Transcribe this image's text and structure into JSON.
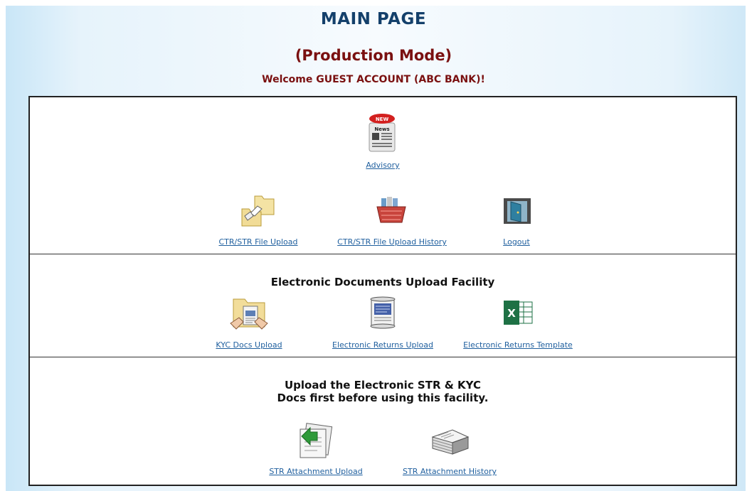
{
  "header": {
    "title": "MAIN PAGE",
    "mode": "(Production Mode)",
    "welcome": "Welcome GUEST ACCOUNT (ABC BANK)!"
  },
  "section_main": {
    "advisory": {
      "label": "Advisory",
      "icon": "news-icon"
    },
    "file_upload": {
      "label": "CTR/STR File Upload",
      "icon": "folder-transfer-icon"
    },
    "upload_history": {
      "label": "CTR/STR File Upload History",
      "icon": "basket-icon"
    },
    "logout": {
      "label": "Logout",
      "icon": "door-icon"
    }
  },
  "section_electronic": {
    "heading": "Electronic Documents Upload Facility",
    "kyc_upload": {
      "label": "KYC Docs Upload",
      "icon": "folder-document-icon"
    },
    "returns_upload": {
      "label": "Electronic Returns Upload",
      "icon": "scroll-icon"
    },
    "returns_template": {
      "label": "Electronic Returns Template",
      "icon": "excel-icon"
    }
  },
  "section_str": {
    "note": "Upload the Electronic STR & KYC Docs first before using this facility.",
    "attachment_upload": {
      "label": "STR Attachment Upload",
      "icon": "attachment-upload-icon"
    },
    "attachment_history": {
      "label": "STR Attachment History",
      "icon": "paper-stack-icon"
    }
  },
  "colors": {
    "title": "#14406b",
    "mode": "#7a1010",
    "link": "#1f5f9e",
    "background_tint": "#c9e6f7"
  }
}
